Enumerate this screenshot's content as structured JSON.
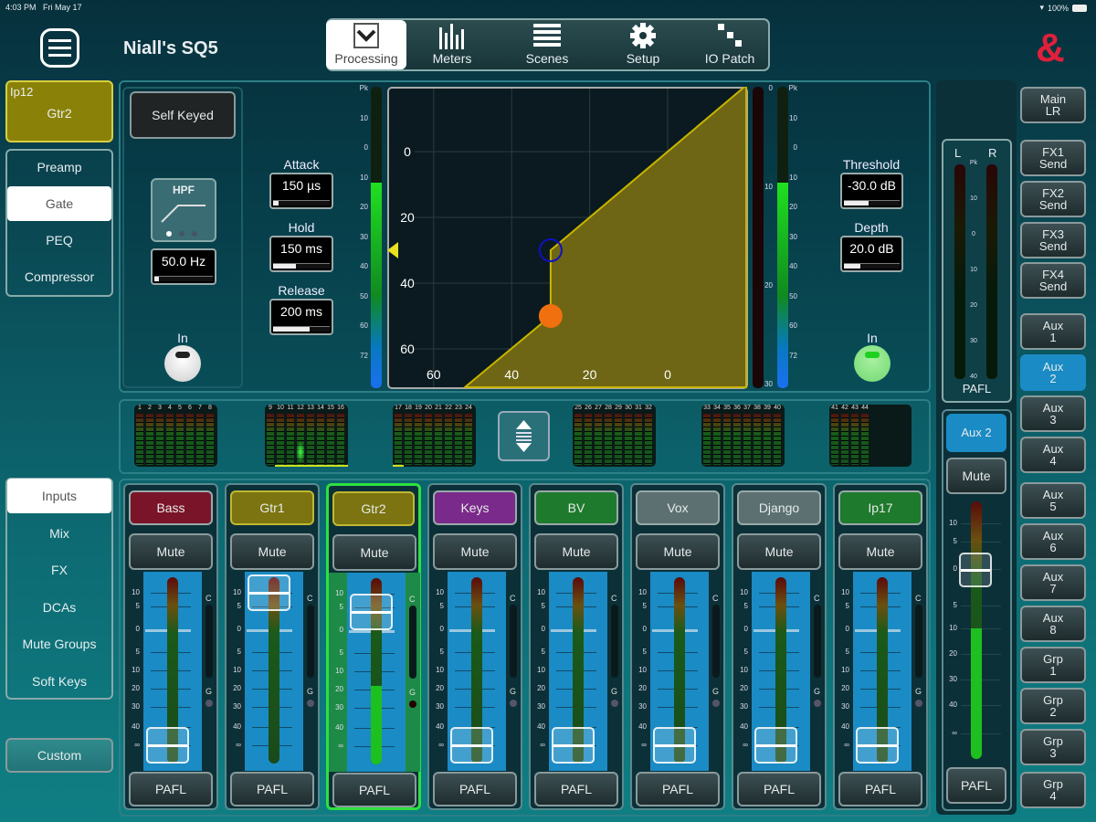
{
  "status_bar": {
    "time": "4:03 PM",
    "date": "Fri May 17",
    "battery": "100%"
  },
  "header": {
    "title": "Niall's SQ5",
    "logo": "&",
    "tabs": [
      {
        "label": "Processing",
        "icon": "processing-icon",
        "active": true
      },
      {
        "label": "Meters",
        "icon": "meters-icon"
      },
      {
        "label": "Scenes",
        "icon": "scenes-icon"
      },
      {
        "label": "Setup",
        "icon": "gear-icon"
      },
      {
        "label": "IO Patch",
        "icon": "io-patch-icon"
      }
    ]
  },
  "channel_select": {
    "number": "Ip12",
    "name": "Gtr2",
    "color": "#8a8208"
  },
  "processing_menu": [
    {
      "label": "Preamp"
    },
    {
      "label": "Gate",
      "selected": true
    },
    {
      "label": "PEQ"
    },
    {
      "label": "Compressor"
    }
  ],
  "gate": {
    "key_source": "Self Keyed",
    "hpf": {
      "label": "HPF",
      "value": "50.0 Hz",
      "fraction": 0.08,
      "in_label": "In",
      "enabled": false
    },
    "attack": {
      "label": "Attack",
      "value": "150 µs",
      "fraction": 0.1
    },
    "hold": {
      "label": "Hold",
      "value": "150 ms",
      "fraction": 0.4
    },
    "release": {
      "label": "Release",
      "value": "200 ms",
      "fraction": 0.65
    },
    "threshold": {
      "label": "Threshold",
      "value": "-30.0 dB",
      "fraction": 0.45,
      "db": -30
    },
    "depth": {
      "label": "Depth",
      "value": "20.0 dB",
      "fraction": 0.3,
      "db": 20
    },
    "in_label": "In",
    "enabled": true,
    "graph": {
      "x_ticks": [
        "60",
        "40",
        "20",
        "0"
      ],
      "y_ticks": [
        "0",
        "20",
        "40",
        "60"
      ],
      "fill_color": "#6e6614",
      "line_color": "#c8b400"
    },
    "input_meter_scale": [
      "Pk",
      "10",
      "0",
      "10",
      "20",
      "30",
      "40",
      "50",
      "60",
      "72"
    ],
    "gr_meter_scale": [
      "0",
      "10",
      "20",
      "30"
    ],
    "input_meter_level_db": -16,
    "output_meter_level_db": -16
  },
  "left_menu": {
    "items": [
      {
        "label": "Inputs",
        "selected": true
      },
      {
        "label": "Mix"
      },
      {
        "label": "FX"
      },
      {
        "label": "DCAs"
      },
      {
        "label": "Mute Groups"
      },
      {
        "label": "Soft Keys"
      }
    ],
    "custom": "Custom"
  },
  "meter_bridge": {
    "groups": [
      [
        "1",
        "2",
        "3",
        "4",
        "5",
        "6",
        "7",
        "8"
      ],
      [
        "9",
        "10",
        "11",
        "12",
        "13",
        "14",
        "15",
        "16"
      ],
      [
        "17",
        "18",
        "19",
        "20",
        "21",
        "22",
        "23",
        "24"
      ],
      [
        "25",
        "26",
        "27",
        "28",
        "29",
        "30",
        "31",
        "32"
      ],
      [
        "33",
        "34",
        "35",
        "36",
        "37",
        "38",
        "39",
        "40"
      ],
      [
        "41",
        "42",
        "43",
        "44"
      ]
    ]
  },
  "fader_scale": [
    "10",
    "5",
    "0",
    "5",
    "10",
    "20",
    "30",
    "40",
    "∞"
  ],
  "strips": [
    {
      "name": "Bass",
      "color": "#7a1428",
      "mute": "Mute",
      "pafl": "PAFL",
      "fader_db": "-inf",
      "meter_db": "-inf"
    },
    {
      "name": "Gtr1",
      "color": "#7b7410",
      "mute": "Mute",
      "pafl": "PAFL",
      "fader_db": "10",
      "meter_db": "-inf"
    },
    {
      "name": "Gtr2",
      "color": "#7b7410",
      "mute": "Mute",
      "pafl": "PAFL",
      "fader_db": "4",
      "meter_db": "-18",
      "selected": true,
      "gate_active": true
    },
    {
      "name": "Keys",
      "color": "#7a2a8a",
      "mute": "Mute",
      "pafl": "PAFL",
      "fader_db": "-inf",
      "meter_db": "-inf"
    },
    {
      "name": "BV",
      "color": "#1e7a2c",
      "mute": "Mute",
      "pafl": "PAFL",
      "fader_db": "-inf",
      "meter_db": "-inf"
    },
    {
      "name": "Vox",
      "color": "#5c7072",
      "mute": "Mute",
      "pafl": "PAFL",
      "fader_db": "-inf",
      "meter_db": "-inf"
    },
    {
      "name": "Django",
      "color": "#5c7072",
      "mute": "Mute",
      "pafl": "PAFL",
      "fader_db": "-inf",
      "meter_db": "-inf"
    },
    {
      "name": "Ip17",
      "color": "#1e7a2c",
      "mute": "Mute",
      "pafl": "PAFL",
      "fader_db": "-inf",
      "meter_db": "-inf"
    }
  ],
  "strip_labels": {
    "comp": "C",
    "gate": "G"
  },
  "master": {
    "meter_labels": {
      "left": "L",
      "right": "R"
    },
    "meter_scale": [
      "Pk",
      "10",
      "0",
      "10",
      "20",
      "30",
      "40"
    ],
    "meter_pafl": "PAFL",
    "mix_name": "Aux 2",
    "mute": "Mute",
    "pafl": "PAFL",
    "fader_db": "0",
    "meter_db": "-10"
  },
  "mix_buttons": [
    {
      "label": "Main LR"
    },
    {
      "label": "FX1 Send"
    },
    {
      "label": "FX2 Send"
    },
    {
      "label": "FX3 Send"
    },
    {
      "label": "FX4 Send"
    },
    {
      "label": "Aux 1"
    },
    {
      "label": "Aux 2",
      "selected": true
    },
    {
      "label": "Aux 3"
    },
    {
      "label": "Aux 4"
    },
    {
      "label": "Aux 5"
    },
    {
      "label": "Aux 6"
    },
    {
      "label": "Aux 7"
    },
    {
      "label": "Aux 8"
    },
    {
      "label": "Grp 1"
    },
    {
      "label": "Grp 2"
    },
    {
      "label": "Grp 3"
    },
    {
      "label": "Grp 4"
    }
  ],
  "colors": {
    "accent_blue": "#1a8bc4",
    "selected_green": "#2ee040"
  }
}
